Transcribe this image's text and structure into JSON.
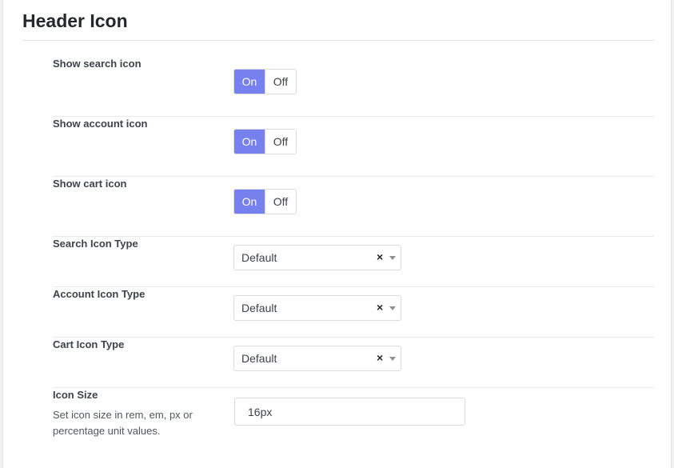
{
  "section": {
    "title": "Header Icon"
  },
  "toggles": [
    {
      "label": "Show search icon",
      "on_label": "On",
      "off_label": "Off",
      "value": "On"
    },
    {
      "label": "Show account icon",
      "on_label": "On",
      "off_label": "Off",
      "value": "On"
    },
    {
      "label": "Show cart icon",
      "on_label": "On",
      "off_label": "Off",
      "value": "On"
    }
  ],
  "selects": [
    {
      "label": "Search Icon Type",
      "value": "Default",
      "clear_glyph": "×"
    },
    {
      "label": "Account Icon Type",
      "value": "Default",
      "clear_glyph": "×"
    },
    {
      "label": "Cart Icon Type",
      "value": "Default",
      "clear_glyph": "×"
    }
  ],
  "icon_size": {
    "label": "Icon Size",
    "description": "Set icon size in rem, em, px or percentage unit values.",
    "value": "16px"
  },
  "colors": {
    "accent": "#7680ee",
    "border": "#dcdcde",
    "text": "#3c434a"
  }
}
